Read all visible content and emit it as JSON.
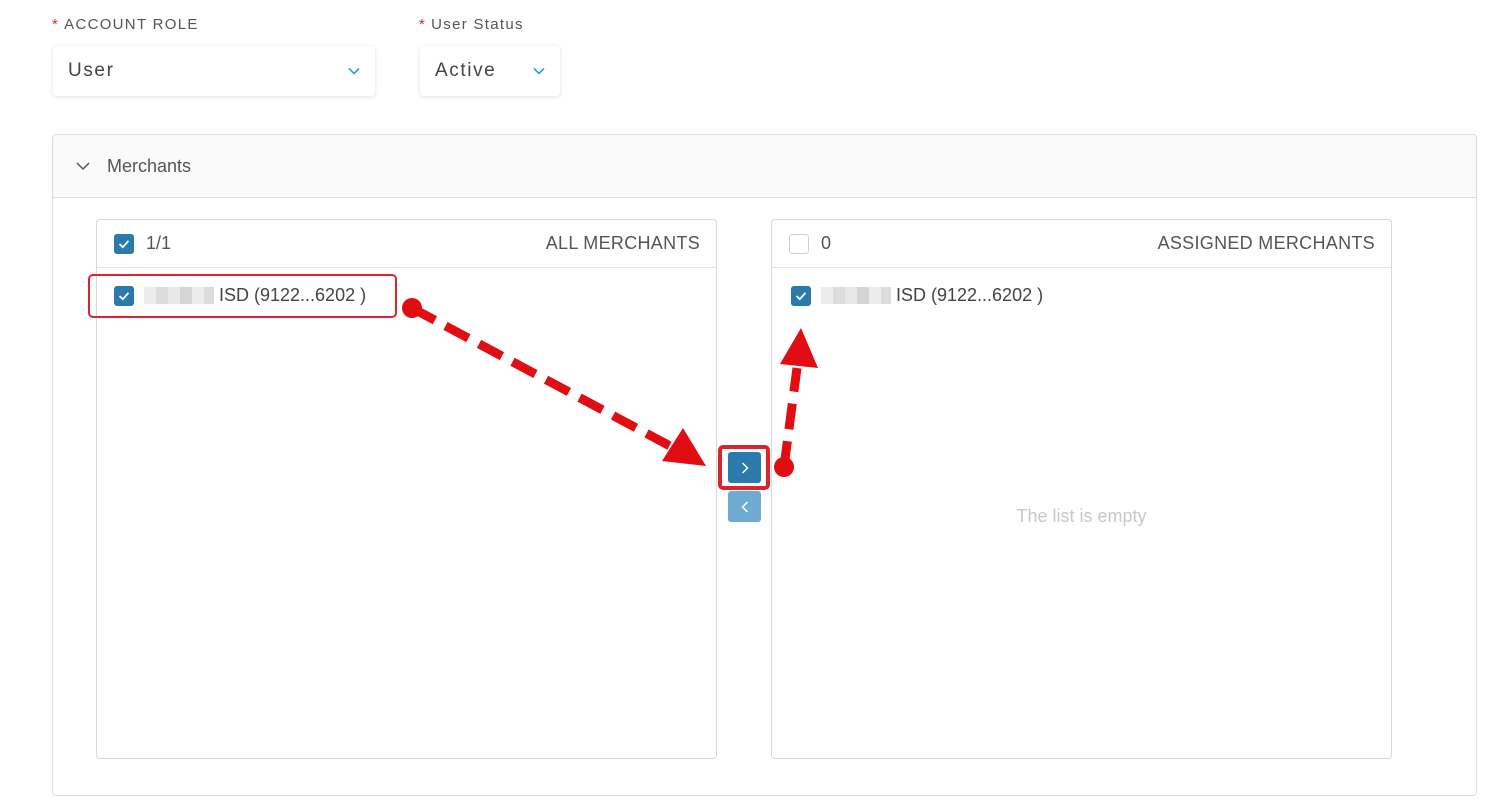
{
  "form": {
    "account_role": {
      "label": "ACCOUNT ROLE",
      "required_mark": "*",
      "value": "User"
    },
    "user_status": {
      "label": "User Status",
      "required_mark": "*",
      "value": "Active"
    }
  },
  "merchants": {
    "header": "Merchants",
    "all_list": {
      "title": "ALL MERCHANTS",
      "count": "1/1",
      "items": [
        {
          "label": "ISD (9122...6202 )",
          "checked": true
        }
      ]
    },
    "assigned_list": {
      "title": "ASSIGNED MERCHANTS",
      "count": "0",
      "items": [
        {
          "label": "ISD (9122...6202 )",
          "checked": true
        }
      ],
      "empty_text": "The list is empty"
    }
  },
  "colors": {
    "primary": "#2a7aad",
    "primary_disabled": "#6eaad2",
    "annotation_red": "#d9262c",
    "required_red": "#e0242c"
  },
  "icons": {
    "select_chevron": "chevron-down-icon",
    "panel_caret": "chevron-down-icon",
    "move_right": "chevron-right-icon",
    "move_left": "chevron-left-icon",
    "checkbox": "check-icon"
  }
}
